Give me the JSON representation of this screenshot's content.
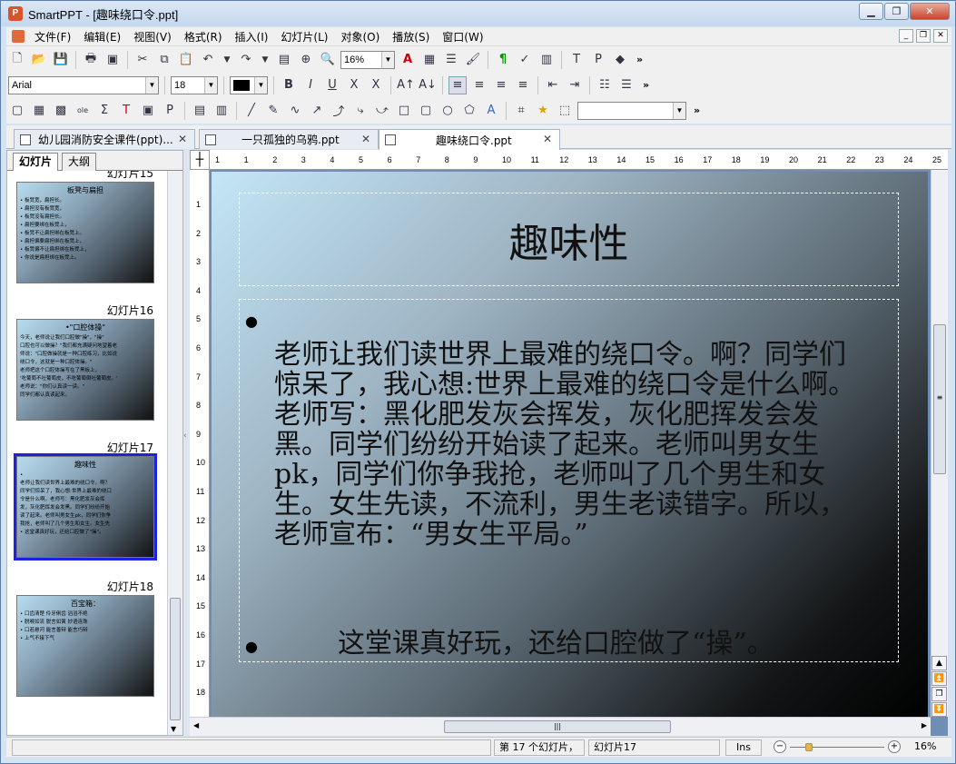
{
  "window": {
    "title": "SmartPPT - [趣味绕口令.ppt]",
    "app_icon": "P"
  },
  "menu": [
    "文件(F)",
    "编辑(E)",
    "视图(V)",
    "格式(R)",
    "插入(I)",
    "幻灯片(L)",
    "对象(O)",
    "播放(S)",
    "窗口(W)"
  ],
  "toolbar": {
    "zoom_value": "16%",
    "font_name": "Arial",
    "font_size": "18",
    "more": "»"
  },
  "doc_tabs": [
    {
      "label": "幼儿园消防安全课件(ppt)..."
    },
    {
      "label": "一只孤独的乌鸦.ppt"
    },
    {
      "label": "趣味绕口令.ppt"
    }
  ],
  "left_panel": {
    "tabs": [
      "幻灯片",
      "大纲"
    ],
    "slides": [
      {
        "label": "幻灯片15",
        "title": "板凳与扁担",
        "lines": [
          "• 板凳宽，扁担长。",
          "• 扁担没有板凳宽，",
          "• 板凳没有扁担长。",
          "• 扁担要绑在板凳上，",
          "• 板凳不让扁担绑在板凳上。",
          "• 扁担偏要扁担绑在板凳上，",
          "• 板凳偏不让扁担绑在板凳上，",
          "• 你说是扁担绑在板凳上。"
        ]
      },
      {
        "label": "幻灯片16",
        "title": "•\"口腔体操\"",
        "lines": [
          "今天，老师说让我们口腔做\"操\"，\"操\"",
          "口腔也可以做操？\"我们都充满疑问地望着老",
          "师说：\"口腔做操就是一种口腔练习，比如说",
          "绕口令，这就是一种口腔体操。\"",
          "老师把这个口腔体操写在了黑板上，",
          "'吃葡萄不吐葡萄皮，不吃葡萄倒吐葡萄皮。'",
          "老师说：\"你们认真读一读。\"",
          "同学们都认真读起来。"
        ]
      },
      {
        "label": "幻灯片17",
        "title": "趣味性",
        "lines": [
          "•",
          "老师让我们读世界上最难的绕口令。啊？",
          "同学们惊呆了，我心想:世界上最难的绕口",
          "令是什么啊。老师写：黑化肥发灰会挥",
          "发，灰化肥挥发会发黑。同学们纷纷开始",
          "读了起来。老师叫男女生pk，同学们你争",
          "我抢，老师叫了几个男生和女生。女生先",
          "• 这堂课真好玩，还给口腔做了\"操\"。"
        ]
      },
      {
        "label": "幻灯片18",
        "title": "百宝箱：",
        "lines": [
          "• 口齿清楚    伶牙俐齿    滔滔不绝",
          "• 脱喉如流    脱言如簧    妙语连珠",
          "• 口若悬河    能言善辩    能言巧辩",
          "• 上气不接下气"
        ]
      }
    ]
  },
  "rulers": {
    "h": [
      "1",
      "1",
      "2",
      "3",
      "4",
      "5",
      "6",
      "7",
      "8",
      "9",
      "10",
      "11",
      "12",
      "13",
      "14",
      "15",
      "16",
      "17",
      "18",
      "19",
      "20",
      "21",
      "22",
      "23",
      "24",
      "25"
    ],
    "v": [
      "1",
      "2",
      "3",
      "4",
      "5",
      "6",
      "7",
      "8",
      "9",
      "10",
      "11",
      "12",
      "13",
      "14",
      "15",
      "16",
      "17",
      "18"
    ]
  },
  "slide": {
    "title": "趣味性",
    "body_text": "老师让我们读世界上最难的绕口令。啊？同学们惊呆了，我心想:世界上最难的绕口令是什么啊。老师写：黑化肥发灰会挥发，灰化肥挥发会发黑。同学们纷纷开始读了起来。老师叫男女生pk，同学们你争我抢，老师叫了几个男生和女生。女生先读，不流利，男生老读错字。所以，老师宣布：“男女生平局。”",
    "body_text2": "这堂课真好玩，还给口腔做了“操”。"
  },
  "status": {
    "slide_pos": "第 17 个幻灯片，",
    "slide_name": "幻灯片17",
    "mode": "Ins",
    "zoom": "16%"
  },
  "colors": {
    "selection": "#1b22e0",
    "window_frame": "#d6e3f3"
  }
}
